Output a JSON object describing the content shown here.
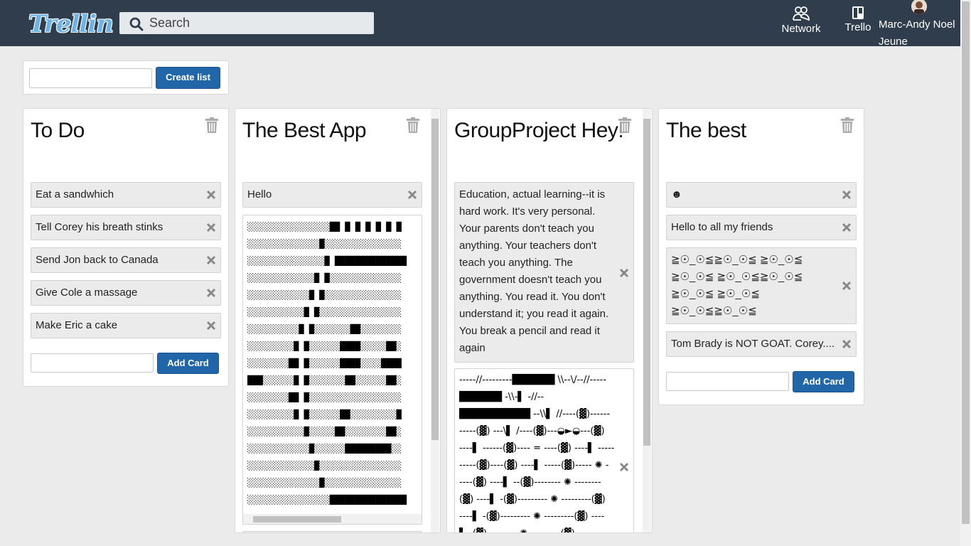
{
  "header": {
    "logo_text": "Trellin",
    "search_placeholder": "Search",
    "nav": [
      {
        "label": "Network",
        "icon": "network-icon"
      },
      {
        "label": "Trello",
        "icon": "trello-board-icon"
      }
    ],
    "user_name": "Marc-Andy Noel Jeune"
  },
  "create_list": {
    "input_value": "",
    "button_label": "Create list"
  },
  "lists": [
    {
      "title": "To Do",
      "cards": [
        "Eat a sandwhich",
        "Tell Corey his breath stinks",
        "Send Jon back to Canada",
        "Give Cole a massage",
        "Make Eric a cake"
      ],
      "add_button_label": "Add Card"
    },
    {
      "title": "The Best App",
      "cards": [
        "Hello"
      ],
      "art_lines": [
        "░░░░░░░░░░░░░░░░██ █ █ █ █ █ █",
        "░░░░░░░░░░░░░░█░░░░░░░░░░░░░░░",
        "░░░░░░░░░░░░░░░█ ██████████████",
        "░░░░░░░░░░░░░█ █░░░░░░░░░░░░░░",
        "░░░░░░░░░░░░█ █░░░░░░░░░░░░░░░",
        "░░░░░░░░░░░█ █░░░░░░░░░░░░░░░░",
        "░░░░░░░░░░█ █░░░░░░░██░░░░░░░░",
        "░░░░░░░░░█ █░░░░░░████░░░░░██░",
        "░░░░░░░░██ █░░░░░░████░░░░████",
        "███░░░░░░█ █░░░░░░░██░░░░░░██░",
        "░░░░░░░░██ █░░░░░░░░░░░░░░░░░░",
        "░░░░░░░░░█ █░░░░░░██░░░░░░░░░█",
        "░░░░░░░░░░░█░░░░░██░░░░░░░░██░",
        "░░░░░░░░░░░░█░░░░░░█████████░░",
        "░░░░░░░░░░░░░█░░░░░░░░░░░░░░░░",
        "░░░░░░░░░░░░░░█░░░░░░░░░░░░░░░",
        "░░░░░░░░░░░░░░░░███████████████"
      ]
    },
    {
      "title": "GroupProject Hey!",
      "cards": [
        "Education, actual learning--it is hard work. It's very personal. Your parents don't teach you anything. Your teachers don't teach you anything. The government doesn't teach you anything. You read it. You don't understand it; you read it again. You break a pencil and read it again"
      ],
      "art_lines": [
        "-----//---------██████ \\\\--\\/--//-----",
        "██████ -\\\\-▌ -//--",
        "██████████ --\\\\▌ //----(▓)------",
        "-----(▓) ---\\▌ /----(▓)---◒►◒---(▓)",
        "----▌ ------(▓)---- = ----(▓) ----▌ -----",
        "-----(▓)----(▓) ----▌ -----(▓)----- ✺ -",
        "----(▓) ----▌ --(▓)-------- ✺ --------",
        "(▓) ----▌ -(▓)--------- ✺ ---------(▓)",
        "----▌ -(▓)--------- ✺ ---------(▓) ----",
        "▌ -(▓)--------- ✺ ---------(▓)"
      ]
    },
    {
      "title": "The best",
      "cards": [
        "☻",
        "Hello to all my friends",
        "≧☉_☉≦≧☉_☉≦ ≧☉_☉≦ ≧☉_☉≦ ≧☉_☉≦≧☉_☉≦ ≧☉_☉≦ ≧☉_☉≦ ≧☉_☉≦≧☉_☉≦",
        "Tom Brady is NOT GOAT. Corey...."
      ],
      "add_button_label": "Add Card"
    }
  ],
  "colors": {
    "header_bg": "#2f3d4d",
    "button_bg": "#2166a8",
    "page_bg": "#ebebeb",
    "card_bg": "#ebebeb"
  }
}
